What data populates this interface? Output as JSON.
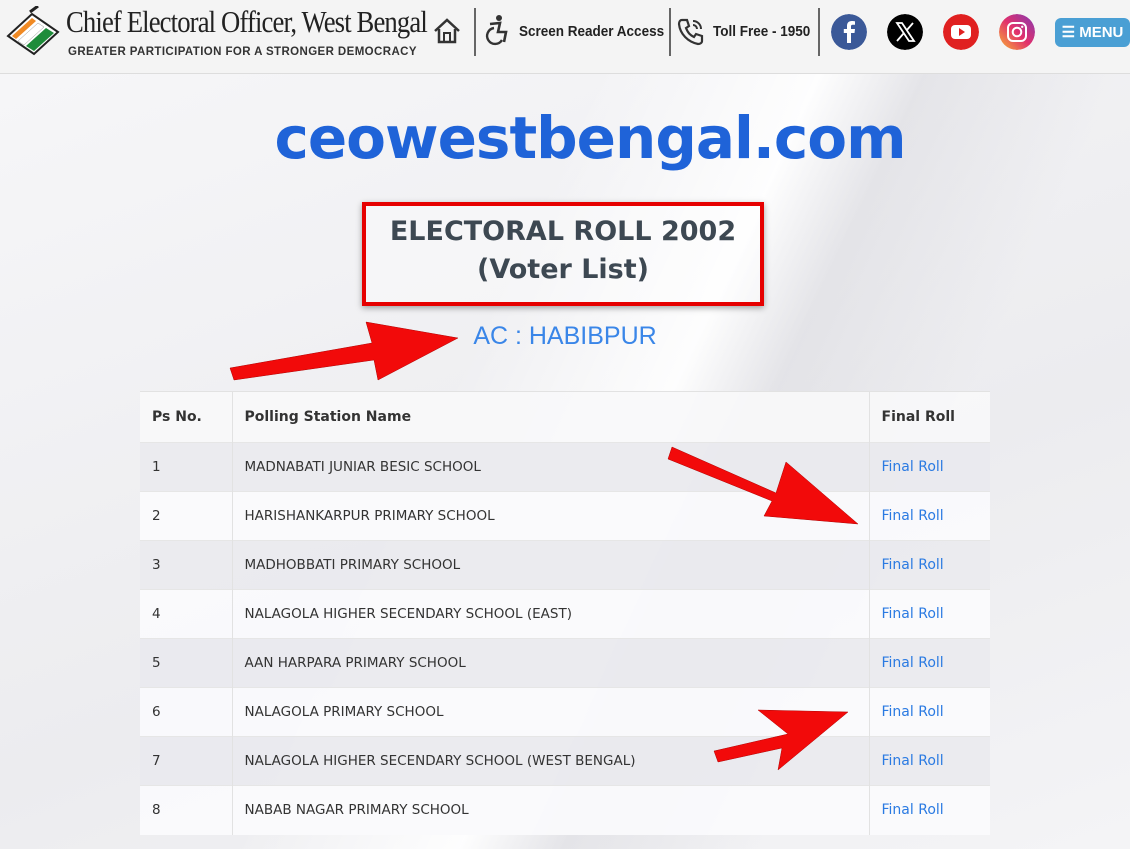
{
  "header": {
    "title": "Chief Electoral Officer, West Bengal",
    "tagline": "GREATER PARTICIPATION FOR A STRONGER DEMOCRACY",
    "screen_reader": "Screen Reader Access",
    "toll_free": "Toll Free - 1950",
    "menu_label": "☰ MENU",
    "social": [
      "facebook-icon",
      "x-icon",
      "youtube-icon",
      "instagram-icon"
    ]
  },
  "main": {
    "site_name": "ceowestbengal.com",
    "title_line1": "ELECTORAL ROLL 2002",
    "title_line2": "(Voter List)",
    "ac_label": "AC : HABIBPUR"
  },
  "table": {
    "headers": [
      "Ps No.",
      "Polling Station Name",
      "Final Roll"
    ],
    "rows": [
      {
        "no": "1",
        "name": "MADNABATI JUNIAR BESIC SCHOOL",
        "link": "Final Roll"
      },
      {
        "no": "2",
        "name": "HARISHANKARPUR PRIMARY SCHOOL",
        "link": "Final Roll"
      },
      {
        "no": "3",
        "name": "MADHOBBATI PRIMARY SCHOOL",
        "link": "Final Roll"
      },
      {
        "no": "4",
        "name": "NALAGOLA HIGHER SECENDARY SCHOOL (EAST)",
        "link": "Final Roll"
      },
      {
        "no": "5",
        "name": "AAN HARPARA PRIMARY SCHOOL",
        "link": "Final Roll"
      },
      {
        "no": "6",
        "name": "NALAGOLA PRIMARY SCHOOL",
        "link": "Final Roll"
      },
      {
        "no": "7",
        "name": "NALAGOLA HIGHER SECENDARY SCHOOL (WEST BENGAL)",
        "link": "Final Roll"
      },
      {
        "no": "8",
        "name": "NABAB NAGAR PRIMARY SCHOOL",
        "link": "Final Roll"
      }
    ]
  },
  "colors": {
    "accent": "#1f63d8",
    "link": "#2a7ae2",
    "highlight": "#e60000",
    "menu": "#4a9fd4"
  }
}
